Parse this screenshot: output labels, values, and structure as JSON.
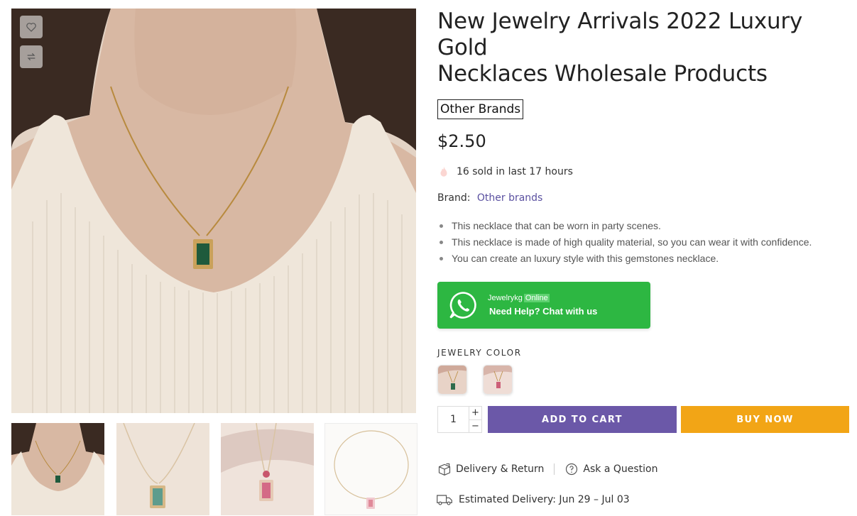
{
  "product": {
    "title_line1": "New Jewelry Arrivals 2022 Luxury Gold",
    "title_line2": "Necklaces Wholesale Products",
    "brand_badge": "Other Brands",
    "price": "$2.50",
    "sold_text": "16 sold in last 17 hours",
    "brand_label": "Brand:",
    "brand_value": "Other brands",
    "bullets": [
      "This necklace that can be worn in party scenes.",
      "This necklace is made of high quality material, so you can wear it with confidence.",
      "You can create an luxury style with this gemstones necklace."
    ]
  },
  "whatsapp": {
    "agent": "Jewelrykg",
    "status": "Online",
    "cta": "Need Help? Chat with us",
    "color": "#2db742"
  },
  "variants": {
    "label": "JEWELRY COLOR",
    "swatches": [
      {
        "name": "green",
        "color": "#2e6b4b"
      },
      {
        "name": "pink",
        "color": "#cc5f78"
      }
    ]
  },
  "cart": {
    "quantity": "1",
    "plus": "+",
    "minus": "−",
    "add_to_cart": "ADD TO CART",
    "buy_now": "BUY NOW",
    "add_color": "#6b58a8",
    "buy_color": "#f2a516"
  },
  "links": {
    "delivery_return": "Delivery & Return",
    "ask_question": "Ask a Question"
  },
  "delivery": {
    "text": "Estimated Delivery: Jun 29 – Jul 03"
  },
  "icons": {
    "wishlist": "heart-icon",
    "compare": "compare-arrows-icon",
    "sold": "fire-icon",
    "whatsapp": "whatsapp-icon",
    "delivery_return": "box-return-icon",
    "ask_question": "question-circle-icon",
    "estimated_delivery": "truck-icon"
  }
}
